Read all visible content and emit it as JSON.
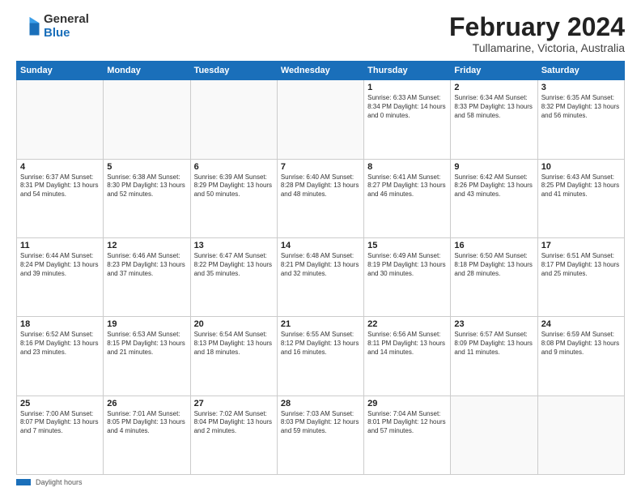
{
  "header": {
    "logo_general": "General",
    "logo_blue": "Blue",
    "month_title": "February 2024",
    "location": "Tullamarine, Victoria, Australia"
  },
  "days_of_week": [
    "Sunday",
    "Monday",
    "Tuesday",
    "Wednesday",
    "Thursday",
    "Friday",
    "Saturday"
  ],
  "footer": {
    "label": "Daylight hours"
  },
  "weeks": [
    [
      {
        "num": "",
        "info": ""
      },
      {
        "num": "",
        "info": ""
      },
      {
        "num": "",
        "info": ""
      },
      {
        "num": "",
        "info": ""
      },
      {
        "num": "1",
        "info": "Sunrise: 6:33 AM\nSunset: 8:34 PM\nDaylight: 14 hours\nand 0 minutes."
      },
      {
        "num": "2",
        "info": "Sunrise: 6:34 AM\nSunset: 8:33 PM\nDaylight: 13 hours\nand 58 minutes."
      },
      {
        "num": "3",
        "info": "Sunrise: 6:35 AM\nSunset: 8:32 PM\nDaylight: 13 hours\nand 56 minutes."
      }
    ],
    [
      {
        "num": "4",
        "info": "Sunrise: 6:37 AM\nSunset: 8:31 PM\nDaylight: 13 hours\nand 54 minutes."
      },
      {
        "num": "5",
        "info": "Sunrise: 6:38 AM\nSunset: 8:30 PM\nDaylight: 13 hours\nand 52 minutes."
      },
      {
        "num": "6",
        "info": "Sunrise: 6:39 AM\nSunset: 8:29 PM\nDaylight: 13 hours\nand 50 minutes."
      },
      {
        "num": "7",
        "info": "Sunrise: 6:40 AM\nSunset: 8:28 PM\nDaylight: 13 hours\nand 48 minutes."
      },
      {
        "num": "8",
        "info": "Sunrise: 6:41 AM\nSunset: 8:27 PM\nDaylight: 13 hours\nand 46 minutes."
      },
      {
        "num": "9",
        "info": "Sunrise: 6:42 AM\nSunset: 8:26 PM\nDaylight: 13 hours\nand 43 minutes."
      },
      {
        "num": "10",
        "info": "Sunrise: 6:43 AM\nSunset: 8:25 PM\nDaylight: 13 hours\nand 41 minutes."
      }
    ],
    [
      {
        "num": "11",
        "info": "Sunrise: 6:44 AM\nSunset: 8:24 PM\nDaylight: 13 hours\nand 39 minutes."
      },
      {
        "num": "12",
        "info": "Sunrise: 6:46 AM\nSunset: 8:23 PM\nDaylight: 13 hours\nand 37 minutes."
      },
      {
        "num": "13",
        "info": "Sunrise: 6:47 AM\nSunset: 8:22 PM\nDaylight: 13 hours\nand 35 minutes."
      },
      {
        "num": "14",
        "info": "Sunrise: 6:48 AM\nSunset: 8:21 PM\nDaylight: 13 hours\nand 32 minutes."
      },
      {
        "num": "15",
        "info": "Sunrise: 6:49 AM\nSunset: 8:19 PM\nDaylight: 13 hours\nand 30 minutes."
      },
      {
        "num": "16",
        "info": "Sunrise: 6:50 AM\nSunset: 8:18 PM\nDaylight: 13 hours\nand 28 minutes."
      },
      {
        "num": "17",
        "info": "Sunrise: 6:51 AM\nSunset: 8:17 PM\nDaylight: 13 hours\nand 25 minutes."
      }
    ],
    [
      {
        "num": "18",
        "info": "Sunrise: 6:52 AM\nSunset: 8:16 PM\nDaylight: 13 hours\nand 23 minutes."
      },
      {
        "num": "19",
        "info": "Sunrise: 6:53 AM\nSunset: 8:15 PM\nDaylight: 13 hours\nand 21 minutes."
      },
      {
        "num": "20",
        "info": "Sunrise: 6:54 AM\nSunset: 8:13 PM\nDaylight: 13 hours\nand 18 minutes."
      },
      {
        "num": "21",
        "info": "Sunrise: 6:55 AM\nSunset: 8:12 PM\nDaylight: 13 hours\nand 16 minutes."
      },
      {
        "num": "22",
        "info": "Sunrise: 6:56 AM\nSunset: 8:11 PM\nDaylight: 13 hours\nand 14 minutes."
      },
      {
        "num": "23",
        "info": "Sunrise: 6:57 AM\nSunset: 8:09 PM\nDaylight: 13 hours\nand 11 minutes."
      },
      {
        "num": "24",
        "info": "Sunrise: 6:59 AM\nSunset: 8:08 PM\nDaylight: 13 hours\nand 9 minutes."
      }
    ],
    [
      {
        "num": "25",
        "info": "Sunrise: 7:00 AM\nSunset: 8:07 PM\nDaylight: 13 hours\nand 7 minutes."
      },
      {
        "num": "26",
        "info": "Sunrise: 7:01 AM\nSunset: 8:05 PM\nDaylight: 13 hours\nand 4 minutes."
      },
      {
        "num": "27",
        "info": "Sunrise: 7:02 AM\nSunset: 8:04 PM\nDaylight: 13 hours\nand 2 minutes."
      },
      {
        "num": "28",
        "info": "Sunrise: 7:03 AM\nSunset: 8:03 PM\nDaylight: 12 hours\nand 59 minutes."
      },
      {
        "num": "29",
        "info": "Sunrise: 7:04 AM\nSunset: 8:01 PM\nDaylight: 12 hours\nand 57 minutes."
      },
      {
        "num": "",
        "info": ""
      },
      {
        "num": "",
        "info": ""
      }
    ]
  ]
}
